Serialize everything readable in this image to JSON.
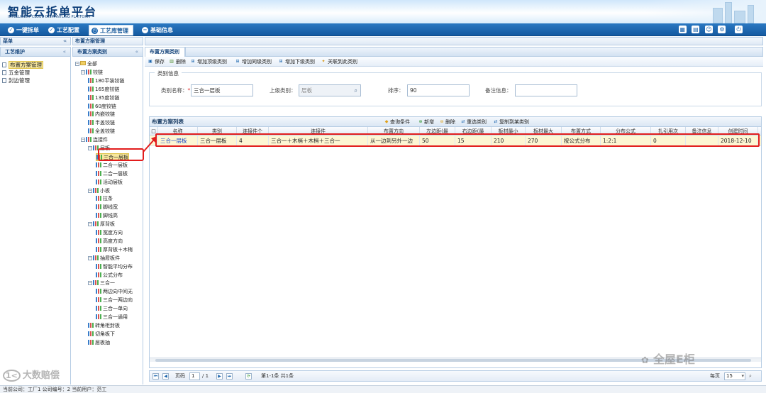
{
  "app": {
    "title": "智能云拆单平台",
    "subtitle": "INTELLIGENT CLOUD DISMANTLING PLATFORM"
  },
  "nav": {
    "tabs": [
      {
        "label": "一键拆单",
        "icon": "check-circle-icon",
        "active": false
      },
      {
        "label": "工艺配置",
        "icon": "check-circle-icon",
        "active": false
      },
      {
        "label": "工艺库管理",
        "icon": "clock-icon",
        "active": true
      },
      {
        "label": "基础信息",
        "icon": "minus-circle-icon",
        "active": false
      }
    ],
    "tool_icons": [
      "calendar-icon",
      "clipboard-icon",
      "user-icon",
      "gear-icon",
      "exit-icon"
    ]
  },
  "left_panel": {
    "header": "菜单",
    "subheader": "工艺维护",
    "collapse_glyph": "«",
    "items": [
      {
        "label": "布置方案管理",
        "selected": true
      },
      {
        "label": "五金管理",
        "selected": false
      },
      {
        "label": "封边管理",
        "selected": false
      }
    ]
  },
  "tree_panel": {
    "header": "布置方案管理",
    "subheader": "布置方案类别",
    "nodes": [
      {
        "label": "全部",
        "type": "folder",
        "level": 0,
        "toggle": "⊟"
      },
      {
        "label": "铰链",
        "type": "group",
        "level": 1,
        "toggle": "⊟"
      },
      {
        "label": "180平装铰链",
        "type": "leaf",
        "level": 2
      },
      {
        "label": "165度铰链",
        "type": "leaf",
        "level": 2
      },
      {
        "label": "135度铰链",
        "type": "leaf",
        "level": 2
      },
      {
        "label": "60度铰链",
        "type": "leaf",
        "level": 2
      },
      {
        "label": "内嵌铰链",
        "type": "leaf",
        "level": 2
      },
      {
        "label": "半盖铰链",
        "type": "leaf",
        "level": 2
      },
      {
        "label": "全盖铰链",
        "type": "leaf",
        "level": 2
      },
      {
        "label": "连接件",
        "type": "group",
        "level": 1,
        "toggle": "⊟"
      },
      {
        "label": "层板",
        "type": "group",
        "level": 2,
        "toggle": "⊟"
      },
      {
        "label": "三合一层板",
        "type": "leaf",
        "level": 3,
        "highlight": true
      },
      {
        "label": "二合一层板",
        "type": "leaf",
        "level": 3
      },
      {
        "label": "二合一层板",
        "type": "leaf",
        "level": 3
      },
      {
        "label": "活动层板",
        "type": "leaf",
        "level": 3
      },
      {
        "label": "小板",
        "type": "group",
        "level": 2,
        "toggle": "⊟"
      },
      {
        "label": "拉条",
        "type": "leaf",
        "level": 3
      },
      {
        "label": "脚线宽",
        "type": "leaf",
        "level": 3
      },
      {
        "label": "脚线高",
        "type": "leaf",
        "level": 3
      },
      {
        "label": "厚背板",
        "type": "group",
        "level": 2,
        "toggle": "⊟"
      },
      {
        "label": "宽度方向",
        "type": "leaf",
        "level": 3
      },
      {
        "label": "高度方向",
        "type": "leaf",
        "level": 3
      },
      {
        "label": "厚背板＋木梢",
        "type": "leaf",
        "level": 3
      },
      {
        "label": "抽屉板件",
        "type": "group",
        "level": 2,
        "toggle": "⊟"
      },
      {
        "label": "智能平均分布",
        "type": "leaf",
        "level": 3
      },
      {
        "label": "公式分布",
        "type": "leaf",
        "level": 3
      },
      {
        "label": "三合一",
        "type": "group",
        "level": 2,
        "toggle": "⊟"
      },
      {
        "label": "两边向中间无",
        "type": "leaf",
        "level": 3
      },
      {
        "label": "三合一两边向",
        "type": "leaf",
        "level": 3
      },
      {
        "label": "三合一单向",
        "type": "leaf",
        "level": 3
      },
      {
        "label": "三合一通用",
        "type": "leaf",
        "level": 3
      },
      {
        "label": "转角柜封板",
        "type": "leaf",
        "level": 2
      },
      {
        "label": "切角板下",
        "type": "leaf",
        "level": 2
      },
      {
        "label": "层板抽",
        "type": "leaf",
        "level": 2
      }
    ]
  },
  "main": {
    "tab": "布置方案类别",
    "toolbar": [
      {
        "label": "保存",
        "icon": "save-icon"
      },
      {
        "label": "删除",
        "icon": "trash-icon"
      },
      {
        "label": "增加顶级类别",
        "icon": "add-top-icon"
      },
      {
        "label": "增加同级类别",
        "icon": "add-sibling-icon"
      },
      {
        "label": "增加下级类别",
        "icon": "add-child-icon"
      },
      {
        "label": "关联到此类别",
        "icon": "link-icon"
      }
    ],
    "form": {
      "legend": "类别信息",
      "name_label": "类别名称：",
      "required_mark": "*",
      "name_value": "三合一层板",
      "parent_label": "上级类别：",
      "parent_value": "层板",
      "order_label": "排序：",
      "order_value": "90",
      "note_label": "备注信息：",
      "note_value": ""
    },
    "grid": {
      "title": "布置方案列表",
      "actions": [
        {
          "label": "查询条件",
          "icon": "filter-icon"
        },
        {
          "label": "新增",
          "icon": "plus-icon"
        },
        {
          "label": "删除",
          "icon": "minus-icon"
        },
        {
          "label": "重选类别",
          "icon": "reselect-icon"
        },
        {
          "label": "复制到某类别",
          "icon": "copy-icon"
        }
      ],
      "columns": [
        "名称",
        "类别",
        "连接件个",
        "连接件",
        "布置方向",
        "左边距(最",
        "右边距(最",
        "板材最小",
        "板材最大",
        "布置方式",
        "分布公式",
        "扎引用次",
        "备注信息",
        "创建时间"
      ],
      "rows": [
        [
          "三合一层板",
          "三合一层板",
          "4",
          "三合一＋木梢＋木梢＋三合一",
          "从一边到另外一边",
          "50",
          "15",
          "210",
          "270",
          "按公式分布",
          "1:2:1",
          "0",
          "",
          "2018-12-10"
        ]
      ]
    },
    "pager": {
      "page_label": "页码",
      "page_value": "1",
      "total_pages": "/ 1",
      "range_text": "第1-1条  共1条",
      "per_page_label": "每页",
      "per_page_value": "15"
    }
  },
  "status": {
    "text": "当前公司：工厂1   公司编号：2   当前用户：范工"
  },
  "watermarks": {
    "left": "大数赔偿",
    "right": "全屋E柜"
  },
  "colors": {
    "nav_bg": "#1a64ad",
    "title": "#0d3f7a",
    "highlight": "#e21d1d",
    "selected_row": "#fdf6d3"
  }
}
